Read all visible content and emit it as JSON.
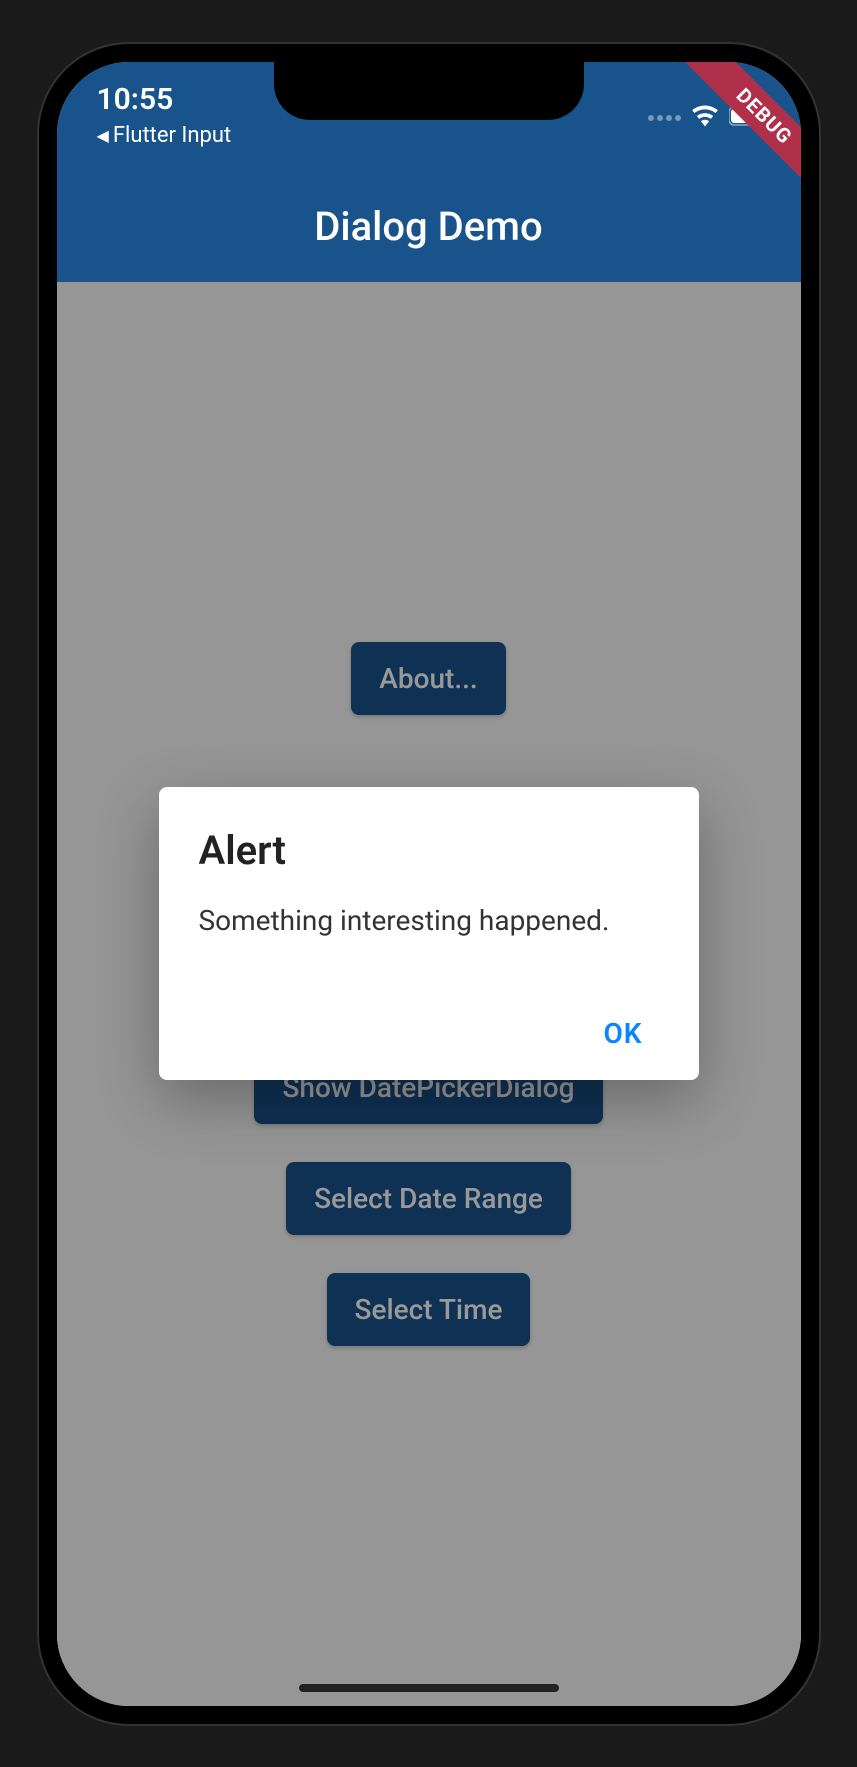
{
  "statusBar": {
    "time": "10:55",
    "breadcrumbText": "Flutter Input"
  },
  "debugBanner": {
    "label": "DEBUG"
  },
  "appBar": {
    "title": "Dialog Demo"
  },
  "buttons": {
    "about": "About...",
    "showDatePicker": "Show DatePickerDialog",
    "selectDateRange": "Select Date Range",
    "selectTime": "Select Time"
  },
  "dialog": {
    "title": "Alert",
    "message": "Something interesting happened.",
    "okLabel": "OK"
  },
  "colors": {
    "primary": "#19538C",
    "debugBanner": "#B0304B",
    "dialogAction": "#0a84ff"
  }
}
